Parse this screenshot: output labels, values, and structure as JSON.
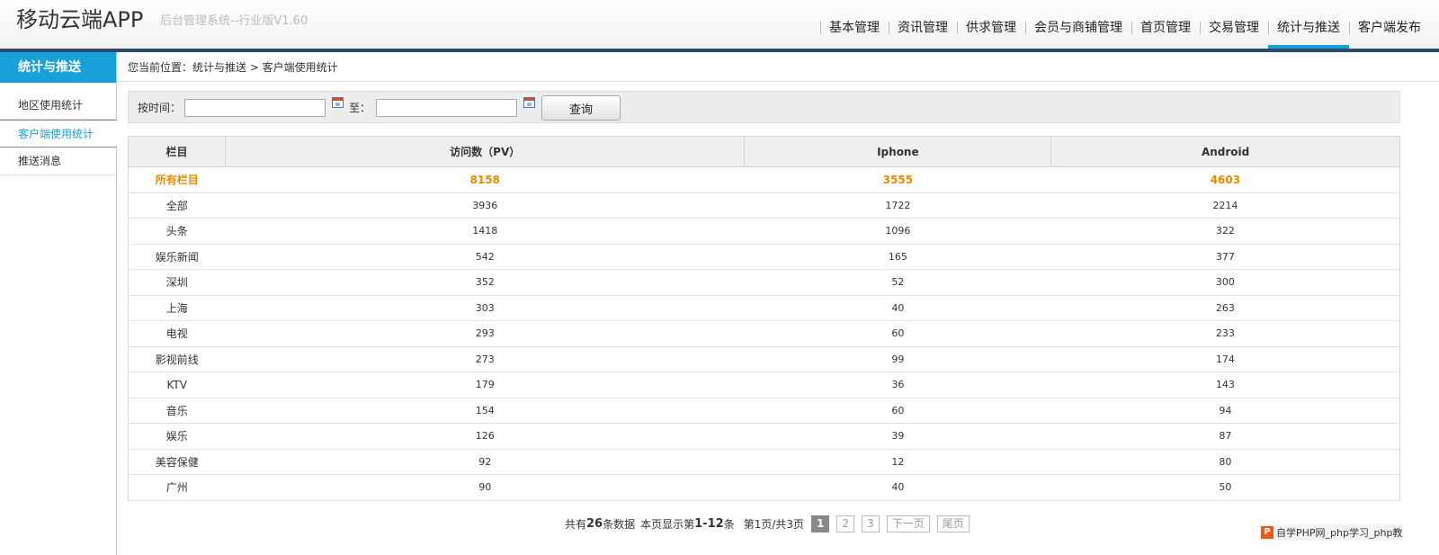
{
  "header": {
    "app_title": "移动云端APP",
    "app_subtitle": "后台管理系统--行业版V1.60",
    "nav": [
      "基本管理",
      "资讯管理",
      "供求管理",
      "会员与商铺管理",
      "首页管理",
      "交易管理",
      "统计与推送",
      "客户端发布"
    ],
    "active_nav": "统计与推送"
  },
  "sidebar": {
    "title": "统计与推送",
    "items": [
      "地区使用统计",
      "客户端使用统计",
      "推送消息"
    ]
  },
  "breadcrumb": "您当前位置：统计与推送 > 客户端使用统计",
  "filter": {
    "label": "按时间：",
    "to_label": "至：",
    "start_value": "",
    "end_value": "",
    "query_label": "查询"
  },
  "table": {
    "headers": [
      "栏目",
      "访问数（PV）",
      "Iphone",
      "Android"
    ],
    "total": {
      "name": "所有栏目",
      "pv": "8158",
      "iphone": "3555",
      "android": "4603"
    },
    "rows": [
      {
        "name": "全部",
        "pv": "3936",
        "iphone": "1722",
        "android": "2214"
      },
      {
        "name": "头条",
        "pv": "1418",
        "iphone": "1096",
        "android": "322"
      },
      {
        "name": "娱乐新闻",
        "pv": "542",
        "iphone": "165",
        "android": "377"
      },
      {
        "name": "深圳",
        "pv": "352",
        "iphone": "52",
        "android": "300"
      },
      {
        "name": "上海",
        "pv": "303",
        "iphone": "40",
        "android": "263"
      },
      {
        "name": "电视",
        "pv": "293",
        "iphone": "60",
        "android": "233"
      },
      {
        "name": "影视前线",
        "pv": "273",
        "iphone": "99",
        "android": "174"
      },
      {
        "name": "KTV",
        "pv": "179",
        "iphone": "36",
        "android": "143"
      },
      {
        "name": "音乐",
        "pv": "154",
        "iphone": "60",
        "android": "94"
      },
      {
        "name": "娱乐",
        "pv": "126",
        "iphone": "39",
        "android": "87"
      },
      {
        "name": "美容保健",
        "pv": "92",
        "iphone": "12",
        "android": "80"
      },
      {
        "name": "广州",
        "pv": "90",
        "iphone": "40",
        "android": "50"
      }
    ]
  },
  "pager": {
    "total_prefix": "共有",
    "total_count": "26",
    "total_suffix": "条数据",
    "show_prefix": "本页显示第",
    "show_range": "1-12",
    "show_suffix": "条",
    "page_info": "第1页/共3页",
    "pages": [
      "1",
      "2",
      "3"
    ],
    "next_label": "下一页",
    "last_label": "尾页"
  },
  "watermark": {
    "logo": "P",
    "text": "自学PHP网_php学习_php教"
  }
}
